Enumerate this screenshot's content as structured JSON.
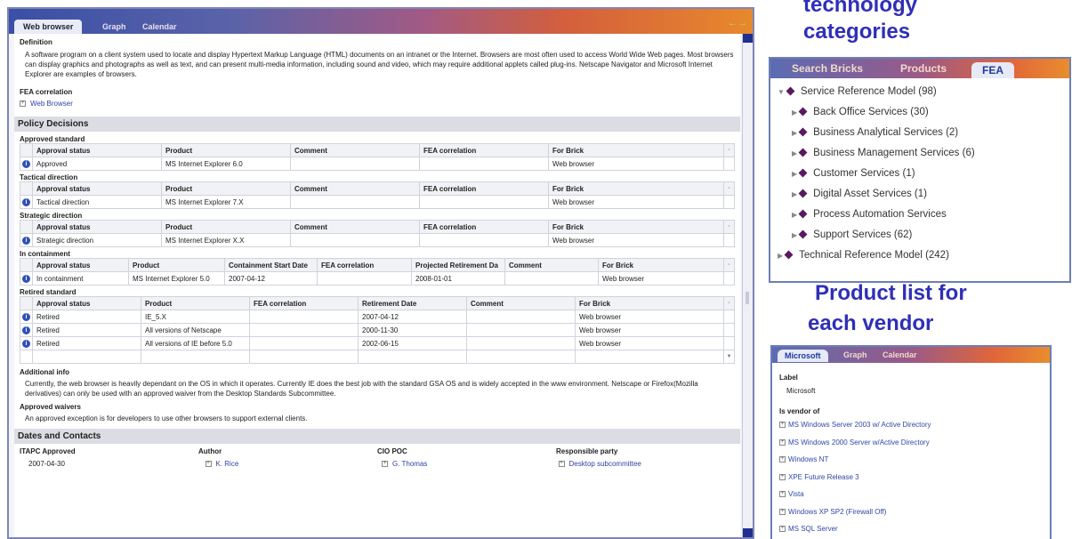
{
  "main_window": {
    "tabs": [
      "Web browser",
      "Graph",
      "Calendar"
    ],
    "definition_label": "Definition",
    "definition_text": "A software program on a client system used to locate and display Hypertext Markup Language (HTML) documents on an intranet or the Internet. Browsers are most often used to access World Wide Web pages. Most browsers can display graphics and photographs as well as text, and can present multi-media information, including sound and video, which may require additional applets called plug-ins. Netscape Navigator and Microsoft Internet Explorer are examples of browsers.",
    "fea_label": "FEA correlation",
    "fea_link": "Web Browser",
    "policy_title": "Policy Decisions",
    "std_headers": [
      "Approval status",
      "Product",
      "Comment",
      "FEA correlation",
      "For Brick"
    ],
    "approved": {
      "label": "Approved standard",
      "row": [
        "Approved",
        "MS Internet Explorer 6.0",
        "",
        "",
        "Web browser"
      ]
    },
    "tactical": {
      "label": "Tactical direction",
      "row": [
        "Tactical direction",
        "MS Internet Explorer 7.X",
        "",
        "",
        "Web browser"
      ]
    },
    "strategic": {
      "label": "Strategic direction",
      "row": [
        "Strategic direction",
        "MS Internet Explorer X.X",
        "",
        "",
        "Web browser"
      ]
    },
    "containment": {
      "label": "In containment",
      "headers": [
        "Approval status",
        "Product",
        "Containment Start Date",
        "FEA correlation",
        "Projected Retirement Da",
        "Comment",
        "For Brick"
      ],
      "row": [
        "In containment",
        "MS Internet Explorer 5.0",
        "2007-04-12",
        "",
        "2008-01-01",
        "",
        "Web browser"
      ]
    },
    "retired": {
      "label": "Retired standard",
      "headers": [
        "Approval status",
        "Product",
        "FEA correlation",
        "Retirement Date",
        "Comment",
        "For Brick"
      ],
      "rows": [
        [
          "Retired",
          "IE_5.X",
          "",
          "2007-04-12",
          "",
          "Web browser"
        ],
        [
          "Retired",
          "All versions of Netscape",
          "",
          "2000-11-30",
          "",
          "Web browser"
        ],
        [
          "Retired",
          "All versions of IE before 5.0",
          "",
          "2002-06-15",
          "",
          "Web browser"
        ]
      ]
    },
    "additional_label": "Additional info",
    "additional_text": "Currently, the web browser is heavily dependant on the OS in which it operates.  Currently IE does the best job with the standard GSA OS and is widely accepted in the www environment.  Netscape or Firefox(Mozilla derivatives) can only be used with an approved waiver from the Desktop Standards Subcommittee.",
    "waivers_label": "Approved waivers",
    "waivers_text": "An approved exception is for developers to use other browsers to support external clients.",
    "dates_title": "Dates and Contacts",
    "contacts_labels": [
      "ITAPC Approved",
      "Author",
      "CIO POC",
      "Responsible party"
    ],
    "contacts_values": [
      "2007-04-30",
      "K. Rice",
      "G. Thomas",
      "Desktop subcommittee"
    ]
  },
  "right": {
    "heading1": [
      "technology",
      "categories"
    ],
    "fea_tabs": [
      "Search Bricks",
      "Products",
      "FEA"
    ],
    "tree": [
      "Service Reference Model  (98)",
      "Back Office Services  (30)",
      "Business Analytical Services  (2)",
      "Business Management Services  (6)",
      "Customer Services  (1)",
      "Digital Asset Services  (1)",
      "Process Automation Services",
      "Support Services  (62)",
      "Technical Reference Model  (242)"
    ],
    "heading2": [
      "Product list for",
      "each vendor"
    ],
    "vendor_tabs": [
      "Microsoft",
      "Graph",
      "Calendar"
    ],
    "label_label": "Label",
    "label_value": "Microsoft",
    "vendor_of_label": "Is vendor of",
    "vendor_items": [
      "MS Windows Server 2003 w/ Active Directory",
      "MS Windows 2000 Server w/Active Directory",
      "Windows NT",
      "XPE Future Release 3",
      "Vista",
      "Windows XP SP2 (Firewall Off)",
      "MS SQL Server"
    ]
  }
}
